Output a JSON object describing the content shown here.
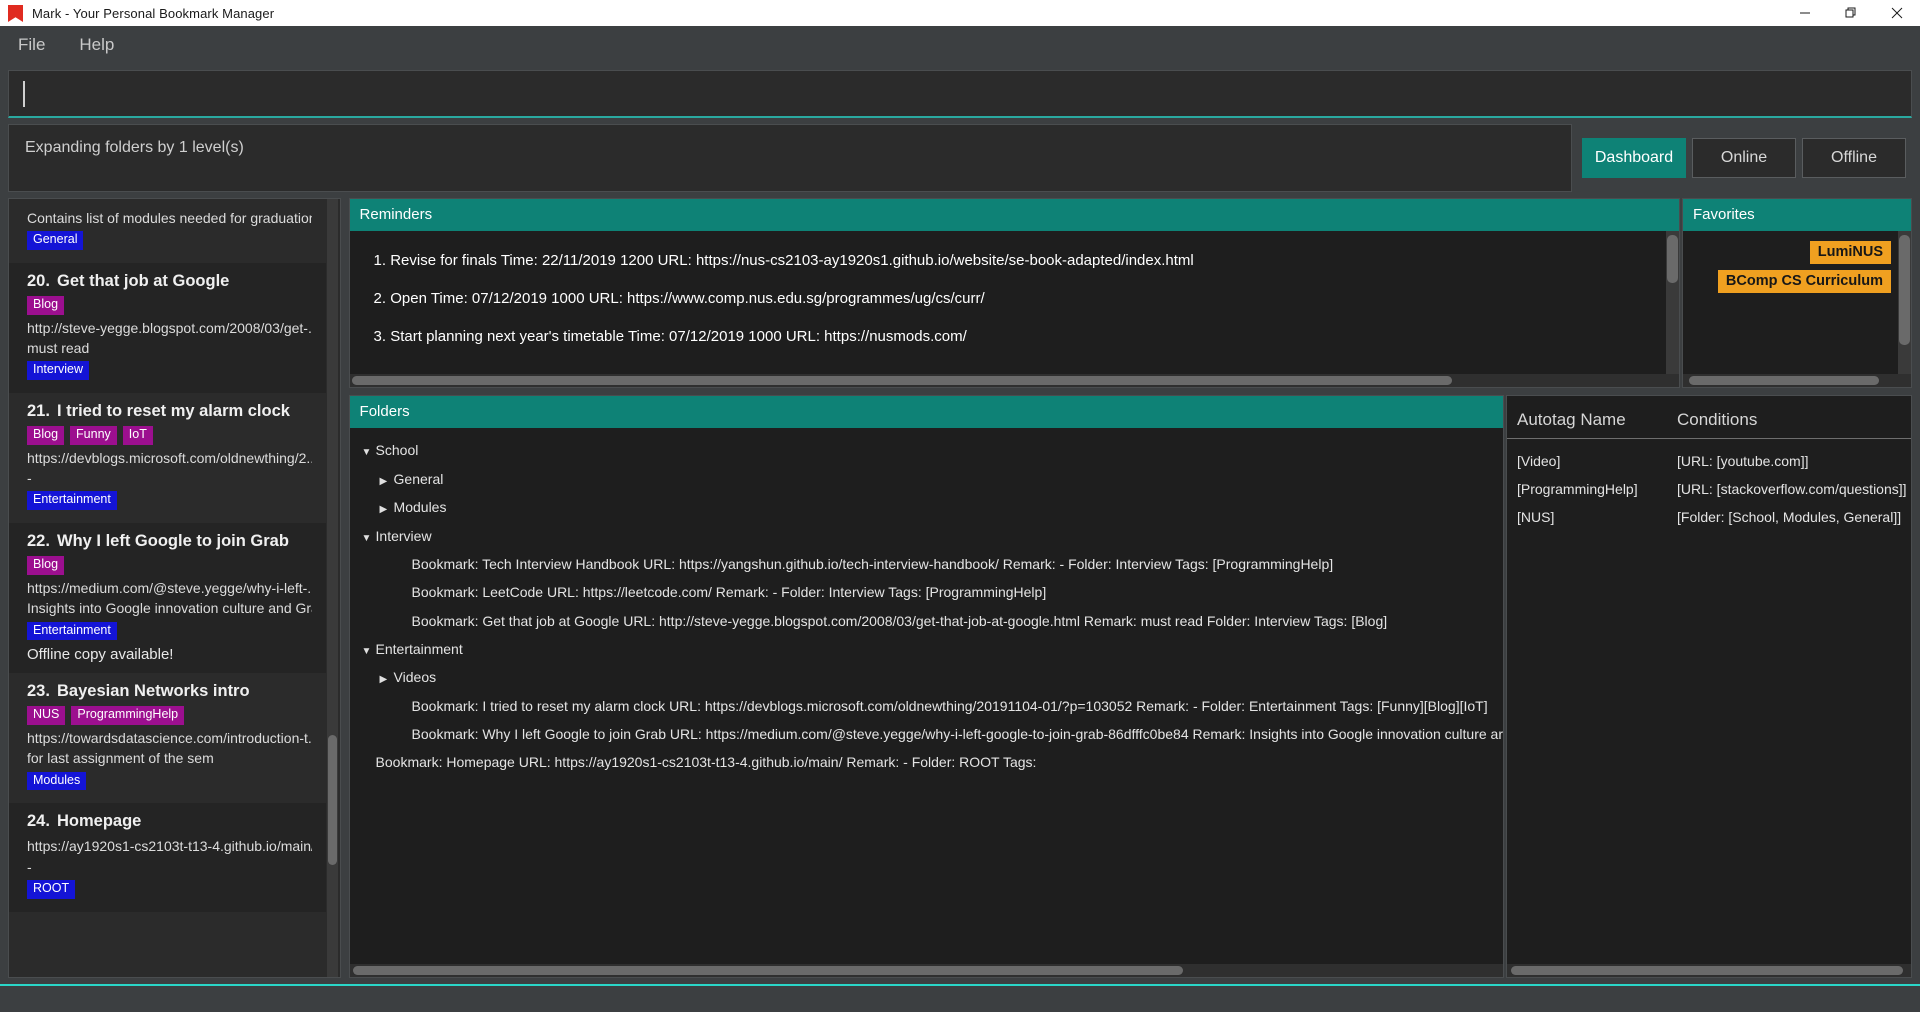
{
  "window": {
    "title": "Mark - Your Personal Bookmark Manager",
    "icon": "bookmark-icon",
    "controls": {
      "minimize": "minimize-icon",
      "maximize": "maximize-icon",
      "close": "close-icon"
    },
    "accent_teal": "#0e8276",
    "accent_cyan": "#2ad6c8"
  },
  "menu": {
    "items": [
      {
        "label": "File"
      },
      {
        "label": "Help"
      }
    ]
  },
  "command": {
    "value": "",
    "placeholder": ""
  },
  "result": {
    "text": "Expanding folders by 1 level(s)"
  },
  "tabs": [
    {
      "label": "Dashboard",
      "active": true
    },
    {
      "label": "Online",
      "active": false
    },
    {
      "label": "Offline",
      "active": false
    }
  ],
  "bookmark_list": {
    "items": [
      {
        "index": "",
        "title": "",
        "tags": [],
        "url": "",
        "remark": "Contains list of modules needed for graduation",
        "folder": "General",
        "note": ""
      },
      {
        "index": "20.",
        "title": "Get that job at Google",
        "tags": [
          "Blog"
        ],
        "url": "http://steve-yegge.blogspot.com/2008/03/get-...",
        "remark": "must read",
        "folder": "Interview",
        "note": ""
      },
      {
        "index": "21.",
        "title": "I tried to reset my alarm clock",
        "tags": [
          "Blog",
          "Funny",
          "IoT"
        ],
        "url": "https://devblogs.microsoft.com/oldnewthing/2...",
        "remark": "-",
        "folder": "Entertainment",
        "note": ""
      },
      {
        "index": "22.",
        "title": "Why I left Google to join Grab",
        "tags": [
          "Blog"
        ],
        "url": "https://medium.com/@steve.yegge/why-i-left-...",
        "remark": "Insights into Google innovation culture and Gra...",
        "folder": "Entertainment",
        "note": "Offline copy available!"
      },
      {
        "index": "23.",
        "title": "Bayesian Networks intro",
        "tags": [
          "NUS",
          "ProgrammingHelp"
        ],
        "url": "https://towardsdatascience.com/introduction-t...",
        "remark": "for last assignment of the sem",
        "folder": "Modules",
        "note": ""
      },
      {
        "index": "24.",
        "title": "Homepage",
        "tags": [],
        "url": "https://ay1920s1-cs2103t-t13-4.github.io/main/",
        "remark": "-",
        "folder": "ROOT",
        "note": ""
      }
    ]
  },
  "reminders": {
    "title": "Reminders",
    "items": [
      "1. Revise for finals Time: 22/11/2019 1200 URL: https://nus-cs2103-ay1920s1.github.io/website/se-book-adapted/index.html",
      "2. Open Time: 07/12/2019 1000 URL: https://www.comp.nus.edu.sg/programmes/ug/cs/curr/",
      "3. Start planning next year's timetable Time: 07/12/2019 1000 URL: https://nusmods.com/"
    ]
  },
  "favorites": {
    "title": "Favorites",
    "items": [
      "LumiNUS",
      "BComp CS Curriculum"
    ]
  },
  "folders": {
    "title": "Folders",
    "rows": [
      {
        "level": 0,
        "marker": "expanded",
        "text": "School"
      },
      {
        "level": 1,
        "marker": "collapsed",
        "text": "General"
      },
      {
        "level": 1,
        "marker": "collapsed",
        "text": "Modules"
      },
      {
        "level": 0,
        "marker": "expanded",
        "text": "Interview"
      },
      {
        "level": 1,
        "marker": "none",
        "text": "Bookmark: Tech Interview Handbook URL: https://yangshun.github.io/tech-interview-handbook/ Remark: - Folder: Interview Tags: [ProgrammingHelp]"
      },
      {
        "level": 1,
        "marker": "none",
        "text": "Bookmark: LeetCode URL: https://leetcode.com/ Remark: - Folder: Interview Tags: [ProgrammingHelp]"
      },
      {
        "level": 1,
        "marker": "none",
        "text": "Bookmark: Get that job at Google URL: http://steve-yegge.blogspot.com/2008/03/get-that-job-at-google.html Remark: must read Folder: Interview Tags: [Blog]"
      },
      {
        "level": 0,
        "marker": "expanded",
        "text": "Entertainment"
      },
      {
        "level": 1,
        "marker": "collapsed",
        "text": "Videos"
      },
      {
        "level": 1,
        "marker": "none",
        "text": "Bookmark: I tried to reset my alarm clock URL: https://devblogs.microsoft.com/oldnewthing/20191104-01/?p=103052 Remark: - Folder: Entertainment Tags: [Funny][Blog][IoT]"
      },
      {
        "level": 1,
        "marker": "none",
        "text": "Bookmark: Why I left Google to join Grab URL: https://medium.com/@steve.yegge/why-i-left-google-to-join-grab-86dfffc0be84 Remark: Insights into Google innovation culture ar"
      },
      {
        "level": 0,
        "marker": "none",
        "text": "Bookmark: Homepage URL: https://ay1920s1-cs2103t-t13-4.github.io/main/ Remark: - Folder: ROOT Tags:"
      }
    ]
  },
  "autotag": {
    "headers": {
      "name": "Autotag Name",
      "conditions": "Conditions"
    },
    "rows": [
      {
        "name": "[Video]",
        "condition": "[URL: [youtube.com]]"
      },
      {
        "name": "[ProgrammingHelp]",
        "condition": "[URL: [stackoverflow.com/questions]]"
      },
      {
        "name": "[NUS]",
        "condition": "[Folder: [School, Modules, General]]"
      }
    ]
  }
}
